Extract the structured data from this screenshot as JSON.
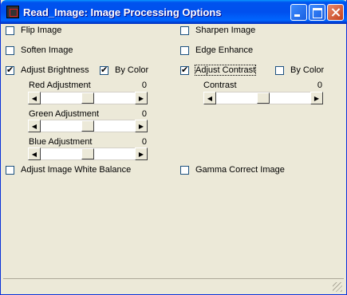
{
  "window": {
    "title": "Read_Image: Image Processing Options"
  },
  "options": {
    "flip_image": {
      "label": "Flip Image",
      "checked": false
    },
    "sharpen_image": {
      "label": "Sharpen Image",
      "checked": false
    },
    "soften_image": {
      "label": "Soften Image",
      "checked": false
    },
    "edge_enhance": {
      "label": "Edge Enhance",
      "checked": false
    },
    "adjust_brightness": {
      "label": "Adjust Brightness",
      "checked": true
    },
    "brightness_by_color": {
      "label": "By Color",
      "checked": true
    },
    "adjust_contrast": {
      "label": "Adjust Contrast",
      "checked": true
    },
    "contrast_by_color": {
      "label": "By Color",
      "checked": false
    },
    "white_balance": {
      "label": "Adjust Image White Balance",
      "checked": false
    },
    "gamma_correct": {
      "label": "Gamma Correct Image",
      "checked": false
    }
  },
  "sliders": {
    "red": {
      "label": "Red Adjustment",
      "value": "0"
    },
    "green": {
      "label": "Green Adjustment",
      "value": "0"
    },
    "blue": {
      "label": "Blue Adjustment",
      "value": "0"
    },
    "contrast": {
      "label": "Contrast",
      "value": "0"
    }
  }
}
